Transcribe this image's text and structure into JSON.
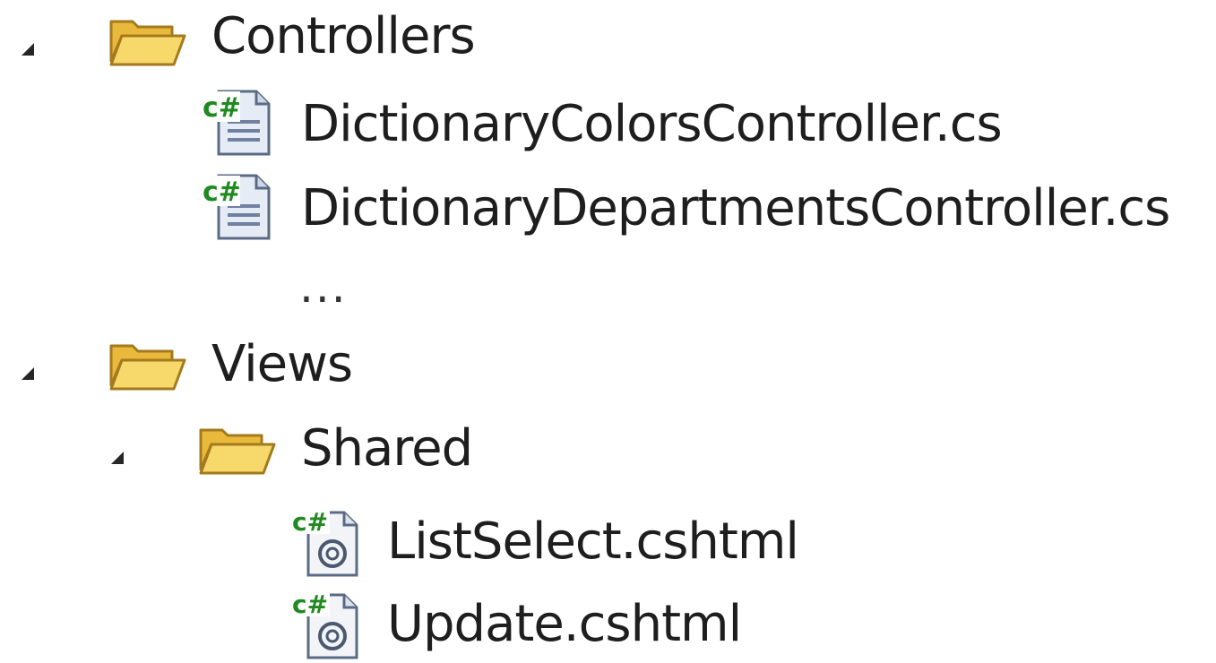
{
  "tree": {
    "items": [
      {
        "label": "Controllers",
        "icon": "folder-open-icon",
        "expanded": true
      },
      {
        "label": "DictionaryColorsController.cs",
        "icon": "csharp-file-icon"
      },
      {
        "label": "DictionaryDepartmentsController.cs",
        "icon": "csharp-file-icon"
      },
      {
        "label": "...",
        "icon": ""
      },
      {
        "label": "Views",
        "icon": "folder-open-icon",
        "expanded": true
      },
      {
        "label": "Shared",
        "icon": "folder-open-icon",
        "expanded": true
      },
      {
        "label": "ListSelect.cshtml",
        "icon": "razor-file-icon"
      },
      {
        "label": "Update.cshtml",
        "icon": "razor-file-icon"
      }
    ]
  },
  "colors": {
    "folder_fill": "#f2c94f",
    "folder_outline": "#a37a1e",
    "csharp_green": "#1f8a1f",
    "text": "#1e1e1e"
  }
}
